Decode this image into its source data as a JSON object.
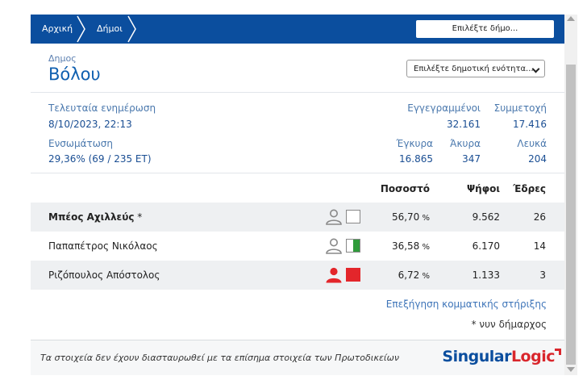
{
  "breadcrumb": {
    "home": "Αρχική",
    "municipalities": "Δήμοι"
  },
  "municipality_picker": {
    "label": "Επιλέξτε δήμο..."
  },
  "municipality": {
    "kicker": "Δημος",
    "name": "Βόλου"
  },
  "unit_select": {
    "selected": "Επιλέξτε δημοτική ενότητα..."
  },
  "stats": {
    "last_update_label": "Τελευταία ενημέρωση",
    "last_update_value": "8/10/2023, 22:13",
    "registered_label": "Εγγεγραμμένοι",
    "registered_value": "32.161",
    "turnout_label": "Συμμετοχή",
    "turnout_value": "17.416",
    "integration_label": "Ενσωμάτωση",
    "integration_value": "29,36% (69 / 235 ΕΤ)",
    "valid_label": "Έγκυρα",
    "valid_value": "16.865",
    "invalid_label": "Άκυρα",
    "invalid_value": "347",
    "blank_label": "Λευκά",
    "blank_value": "204"
  },
  "table": {
    "headers": {
      "percent": "Ποσοστό",
      "votes": "Ψήφοι",
      "seats": "Έδρες"
    },
    "rows": [
      {
        "name": "Μπέος Αχιλλεύς",
        "marker": " *",
        "percent": "56,70",
        "unit": " %",
        "votes": "9.562",
        "seats": "26"
      },
      {
        "name": "Παπαπέτρος Νικόλαος",
        "marker": "",
        "percent": "36,58",
        "unit": " %",
        "votes": "6.170",
        "seats": "14"
      },
      {
        "name": "Ριζόπουλος Απόστολος",
        "marker": "",
        "percent": "6,72",
        "unit": " %",
        "votes": "1.133",
        "seats": "3"
      }
    ]
  },
  "party_support_link": "Επεξήγηση κομματικής στήριξης",
  "mayor_note": "* νυν δήμαρχος",
  "footer": {
    "note": "Τα στοιχεία δεν έχουν διασταυρωθεί με τα επίσημα στοιχεία των Πρωτοδικείων",
    "logo_part1": "Singular",
    "logo_part2": "Logic"
  },
  "colors": {
    "brand_blue": "#0b4e9e",
    "red": "#e3262b",
    "green": "#2e9b3a",
    "gray_icon": "#888888"
  }
}
